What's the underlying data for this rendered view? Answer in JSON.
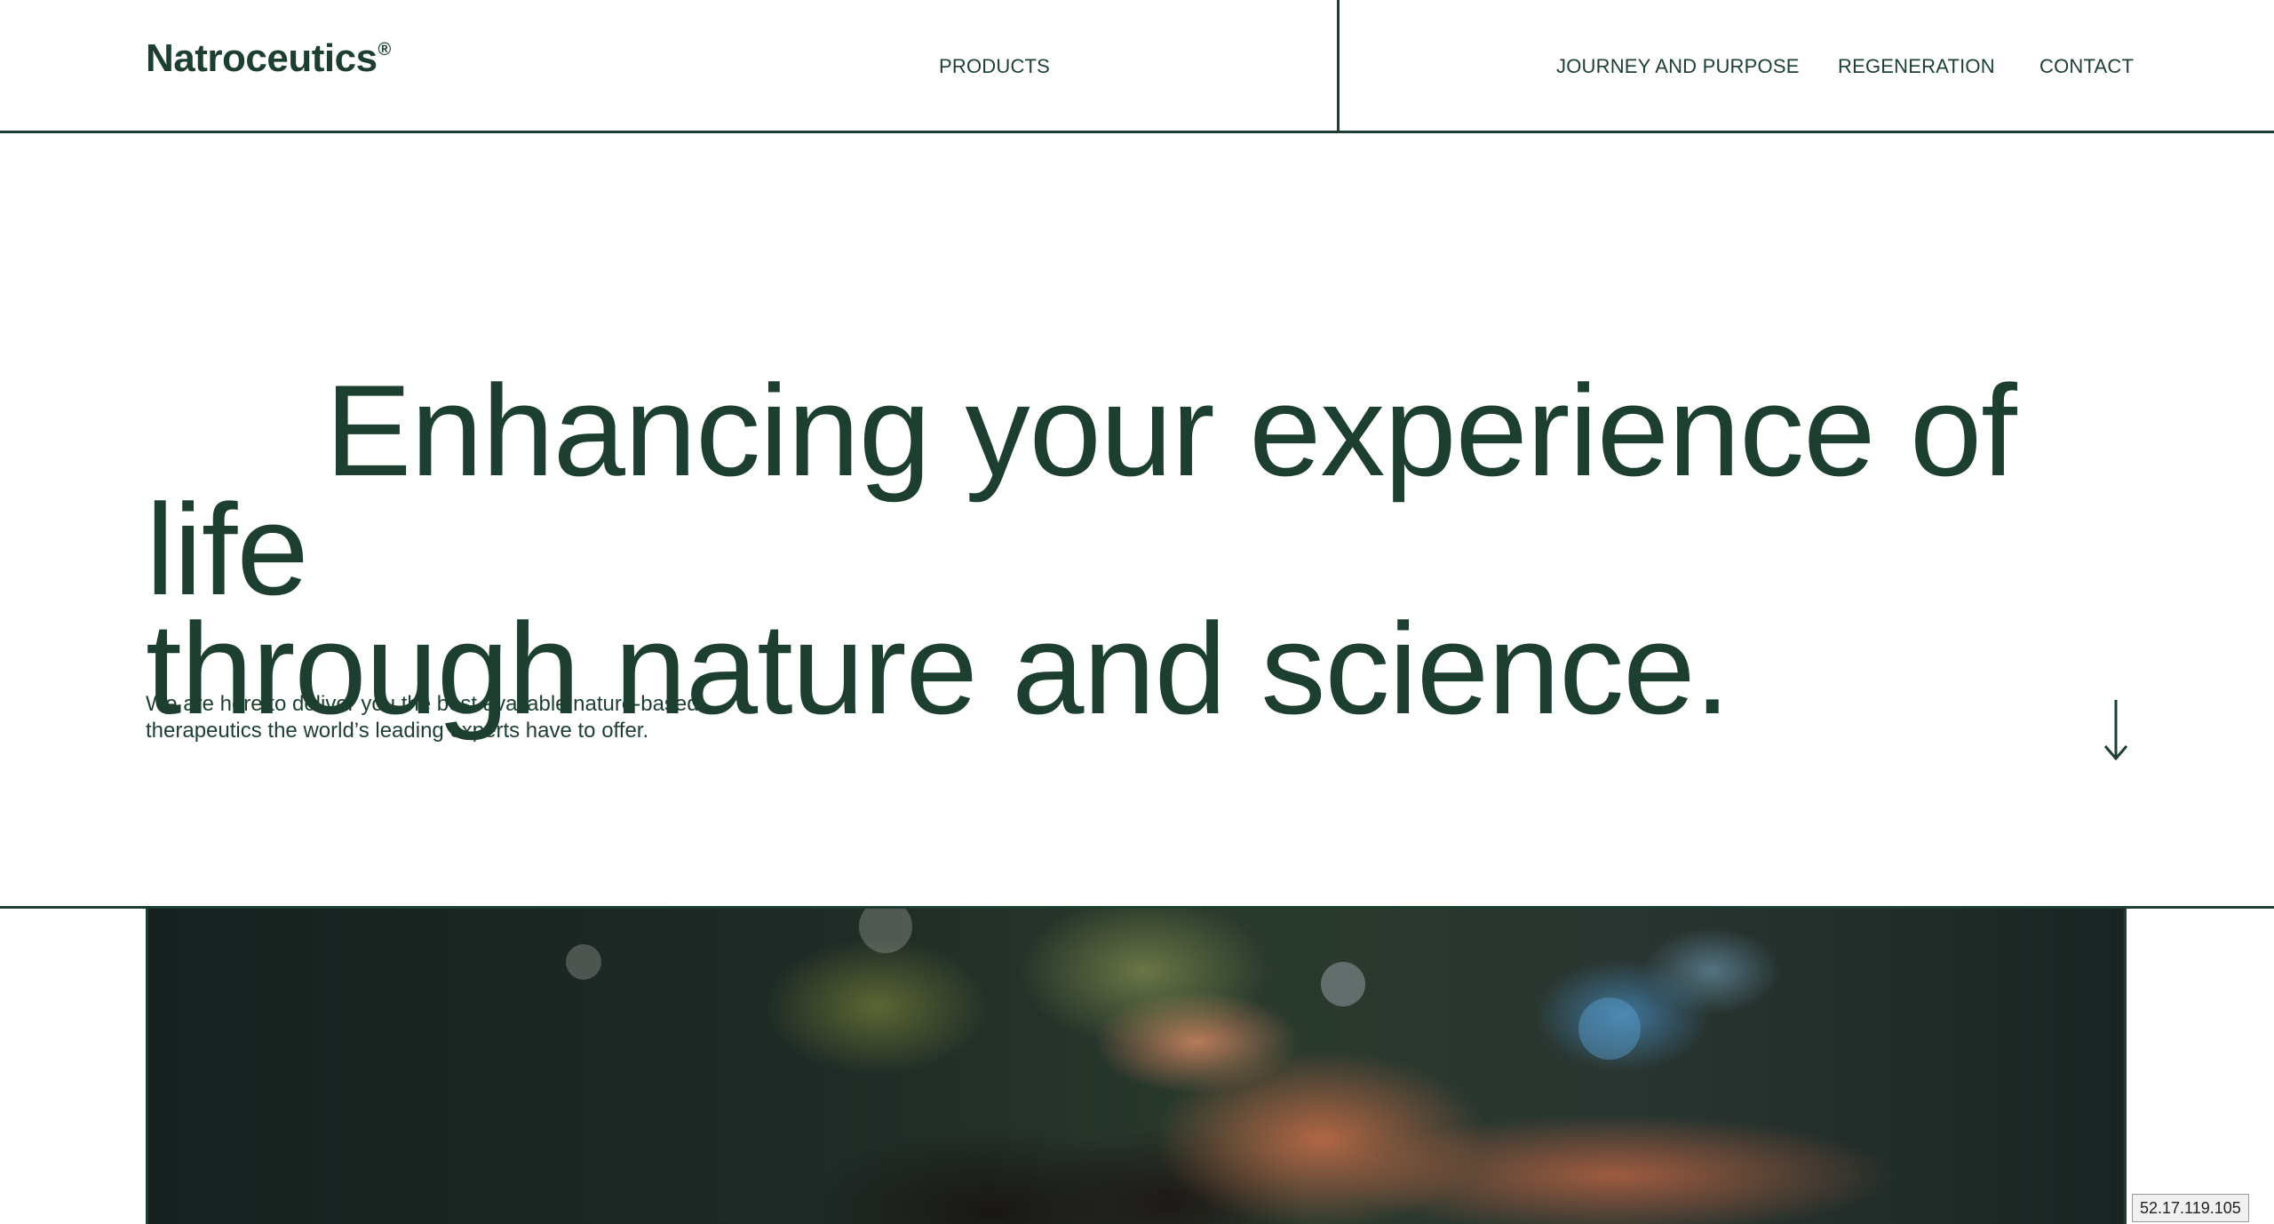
{
  "header": {
    "logo": "Natroceutics",
    "logo_mark": "®",
    "nav": {
      "products": "PRODUCTS",
      "journey": "JOURNEY AND PURPOSE",
      "regeneration": "REGENERATION",
      "contact": "CONTACT"
    }
  },
  "hero": {
    "title_line1": "Enhancing your experience of life",
    "title_line2": "through nature and science.",
    "subtitle_line1": "We are here to deliver you the best available nature-based",
    "subtitle_line2": "therapeutics the world’s leading experts have to offer.",
    "scroll_icon": "arrow-down-icon"
  },
  "media": {
    "description_icon": "video-frame"
  },
  "overlay": {
    "ip": "52.17.119.105"
  },
  "colors": {
    "brand": "#1d3f30",
    "background": "#ffffff"
  }
}
